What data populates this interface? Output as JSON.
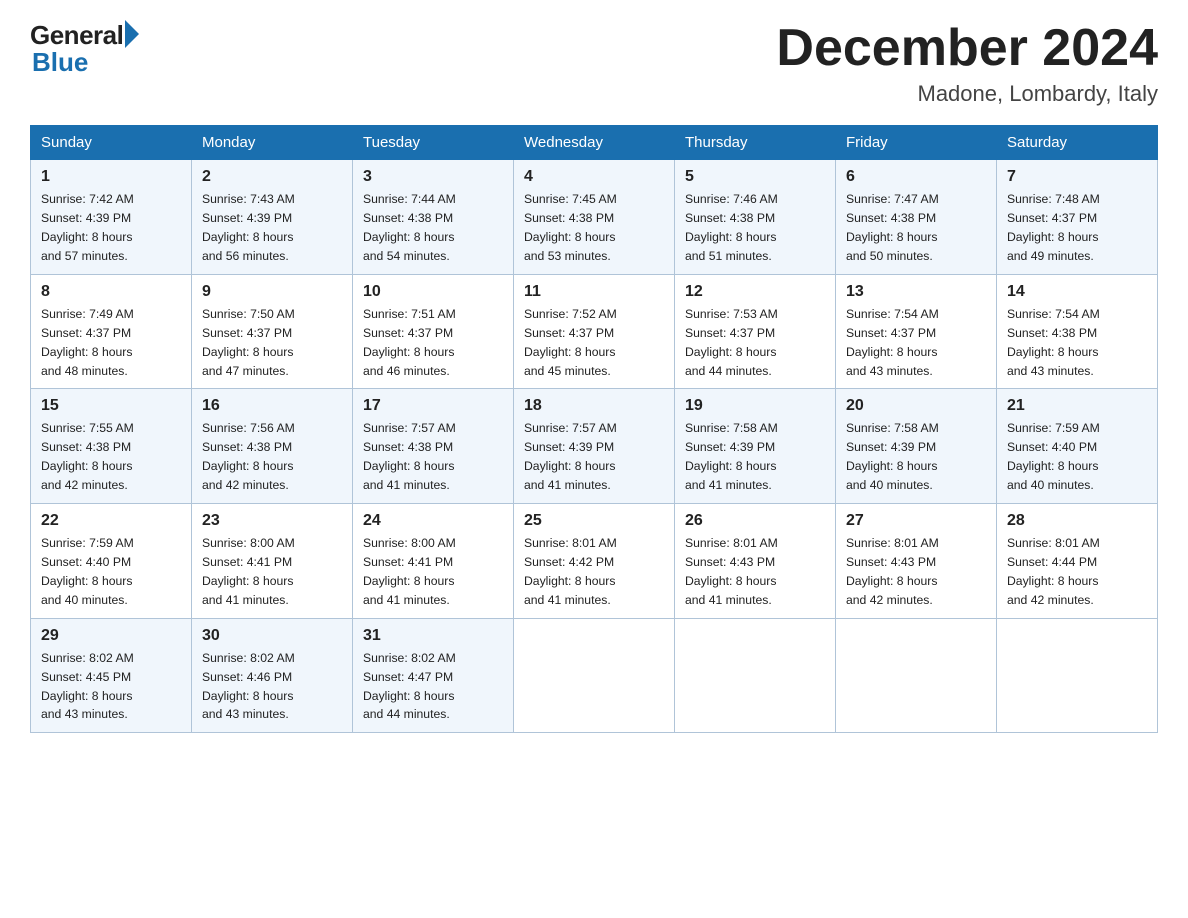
{
  "logo": {
    "general": "General",
    "blue": "Blue"
  },
  "header": {
    "month": "December 2024",
    "location": "Madone, Lombardy, Italy"
  },
  "weekdays": [
    "Sunday",
    "Monday",
    "Tuesday",
    "Wednesday",
    "Thursday",
    "Friday",
    "Saturday"
  ],
  "weeks": [
    [
      {
        "day": "1",
        "sunrise": "7:42 AM",
        "sunset": "4:39 PM",
        "daylight": "8 hours and 57 minutes."
      },
      {
        "day": "2",
        "sunrise": "7:43 AM",
        "sunset": "4:39 PM",
        "daylight": "8 hours and 56 minutes."
      },
      {
        "day": "3",
        "sunrise": "7:44 AM",
        "sunset": "4:38 PM",
        "daylight": "8 hours and 54 minutes."
      },
      {
        "day": "4",
        "sunrise": "7:45 AM",
        "sunset": "4:38 PM",
        "daylight": "8 hours and 53 minutes."
      },
      {
        "day": "5",
        "sunrise": "7:46 AM",
        "sunset": "4:38 PM",
        "daylight": "8 hours and 51 minutes."
      },
      {
        "day": "6",
        "sunrise": "7:47 AM",
        "sunset": "4:38 PM",
        "daylight": "8 hours and 50 minutes."
      },
      {
        "day": "7",
        "sunrise": "7:48 AM",
        "sunset": "4:37 PM",
        "daylight": "8 hours and 49 minutes."
      }
    ],
    [
      {
        "day": "8",
        "sunrise": "7:49 AM",
        "sunset": "4:37 PM",
        "daylight": "8 hours and 48 minutes."
      },
      {
        "day": "9",
        "sunrise": "7:50 AM",
        "sunset": "4:37 PM",
        "daylight": "8 hours and 47 minutes."
      },
      {
        "day": "10",
        "sunrise": "7:51 AM",
        "sunset": "4:37 PM",
        "daylight": "8 hours and 46 minutes."
      },
      {
        "day": "11",
        "sunrise": "7:52 AM",
        "sunset": "4:37 PM",
        "daylight": "8 hours and 45 minutes."
      },
      {
        "day": "12",
        "sunrise": "7:53 AM",
        "sunset": "4:37 PM",
        "daylight": "8 hours and 44 minutes."
      },
      {
        "day": "13",
        "sunrise": "7:54 AM",
        "sunset": "4:37 PM",
        "daylight": "8 hours and 43 minutes."
      },
      {
        "day": "14",
        "sunrise": "7:54 AM",
        "sunset": "4:38 PM",
        "daylight": "8 hours and 43 minutes."
      }
    ],
    [
      {
        "day": "15",
        "sunrise": "7:55 AM",
        "sunset": "4:38 PM",
        "daylight": "8 hours and 42 minutes."
      },
      {
        "day": "16",
        "sunrise": "7:56 AM",
        "sunset": "4:38 PM",
        "daylight": "8 hours and 42 minutes."
      },
      {
        "day": "17",
        "sunrise": "7:57 AM",
        "sunset": "4:38 PM",
        "daylight": "8 hours and 41 minutes."
      },
      {
        "day": "18",
        "sunrise": "7:57 AM",
        "sunset": "4:39 PM",
        "daylight": "8 hours and 41 minutes."
      },
      {
        "day": "19",
        "sunrise": "7:58 AM",
        "sunset": "4:39 PM",
        "daylight": "8 hours and 41 minutes."
      },
      {
        "day": "20",
        "sunrise": "7:58 AM",
        "sunset": "4:39 PM",
        "daylight": "8 hours and 40 minutes."
      },
      {
        "day": "21",
        "sunrise": "7:59 AM",
        "sunset": "4:40 PM",
        "daylight": "8 hours and 40 minutes."
      }
    ],
    [
      {
        "day": "22",
        "sunrise": "7:59 AM",
        "sunset": "4:40 PM",
        "daylight": "8 hours and 40 minutes."
      },
      {
        "day": "23",
        "sunrise": "8:00 AM",
        "sunset": "4:41 PM",
        "daylight": "8 hours and 41 minutes."
      },
      {
        "day": "24",
        "sunrise": "8:00 AM",
        "sunset": "4:41 PM",
        "daylight": "8 hours and 41 minutes."
      },
      {
        "day": "25",
        "sunrise": "8:01 AM",
        "sunset": "4:42 PM",
        "daylight": "8 hours and 41 minutes."
      },
      {
        "day": "26",
        "sunrise": "8:01 AM",
        "sunset": "4:43 PM",
        "daylight": "8 hours and 41 minutes."
      },
      {
        "day": "27",
        "sunrise": "8:01 AM",
        "sunset": "4:43 PM",
        "daylight": "8 hours and 42 minutes."
      },
      {
        "day": "28",
        "sunrise": "8:01 AM",
        "sunset": "4:44 PM",
        "daylight": "8 hours and 42 minutes."
      }
    ],
    [
      {
        "day": "29",
        "sunrise": "8:02 AM",
        "sunset": "4:45 PM",
        "daylight": "8 hours and 43 minutes."
      },
      {
        "day": "30",
        "sunrise": "8:02 AM",
        "sunset": "4:46 PM",
        "daylight": "8 hours and 43 minutes."
      },
      {
        "day": "31",
        "sunrise": "8:02 AM",
        "sunset": "4:47 PM",
        "daylight": "8 hours and 44 minutes."
      },
      null,
      null,
      null,
      null
    ]
  ],
  "labels": {
    "sunrise": "Sunrise:",
    "sunset": "Sunset:",
    "daylight": "Daylight:"
  }
}
